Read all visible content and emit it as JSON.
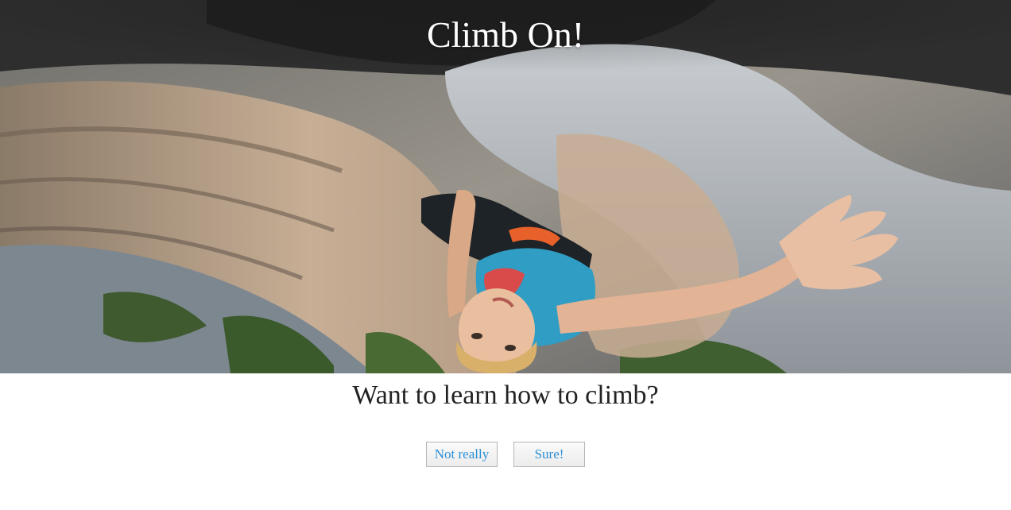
{
  "hero": {
    "title": "Climb On!",
    "image_alt": "climber-photo"
  },
  "prompt": {
    "question": "Want to learn how to climb?"
  },
  "actions": {
    "decline_label": "Not really",
    "accept_label": "Sure!"
  },
  "colors": {
    "button_text": "#2b8fd6",
    "title_text": "#ffffff",
    "question_text": "#222222"
  }
}
